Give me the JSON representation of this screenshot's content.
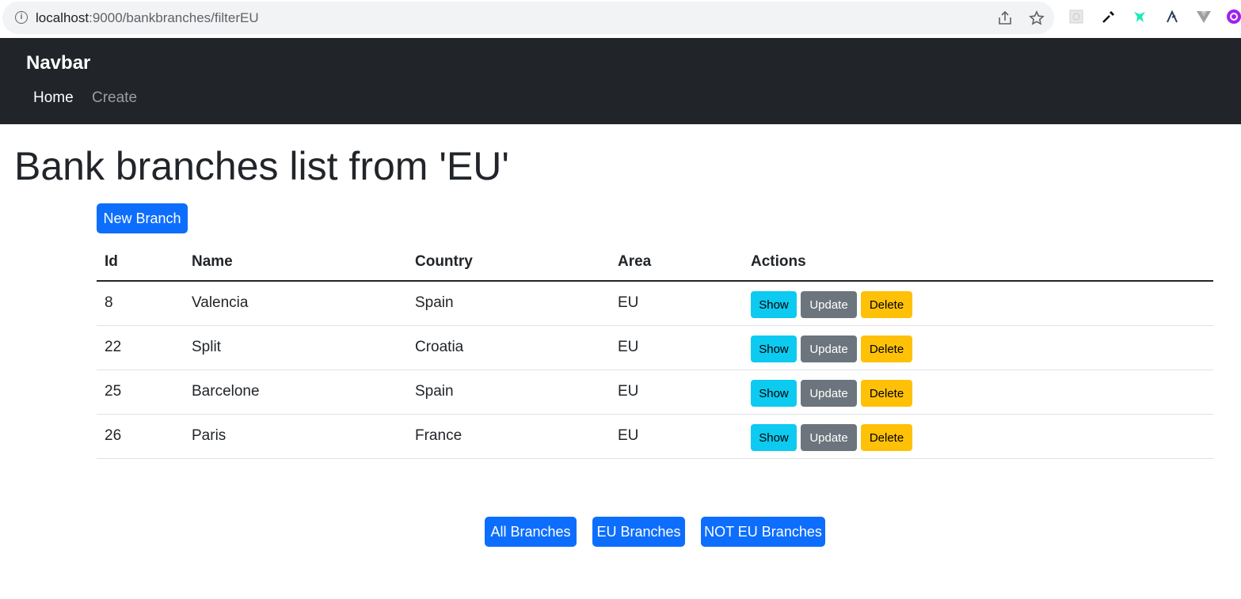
{
  "browser": {
    "url_host": "localhost",
    "url_path": ":9000/bankbranches/filterEU"
  },
  "navbar": {
    "brand": "Navbar",
    "links": [
      {
        "label": "Home",
        "active": true
      },
      {
        "label": "Create",
        "active": false
      }
    ]
  },
  "page": {
    "title": "Bank branches list from 'EU'",
    "new_button": "New Branch"
  },
  "table": {
    "headers": [
      "Id",
      "Name",
      "Country",
      "Area",
      "Actions"
    ],
    "rows": [
      {
        "id": "8",
        "name": "Valencia",
        "country": "Spain",
        "area": "EU"
      },
      {
        "id": "22",
        "name": "Split",
        "country": "Croatia",
        "area": "EU"
      },
      {
        "id": "25",
        "name": "Barcelone",
        "country": "Spain",
        "area": "EU"
      },
      {
        "id": "26",
        "name": "Paris",
        "country": "France",
        "area": "EU"
      }
    ],
    "actions": {
      "show": "Show",
      "update": "Update",
      "delete": "Delete"
    }
  },
  "filters": {
    "all": "All Branches",
    "eu": "EU Branches",
    "not_eu": "NOT EU Branches"
  },
  "colors": {
    "primary": "#0d6efd",
    "info": "#0dcaf0",
    "secondary": "#6c757d",
    "warning": "#ffc107",
    "navbar": "#212529"
  }
}
